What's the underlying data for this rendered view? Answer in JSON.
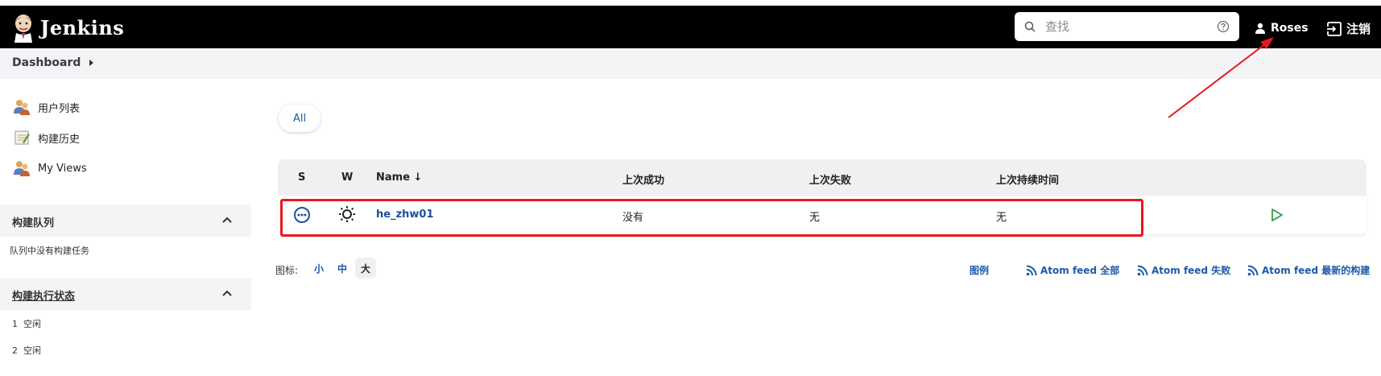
{
  "header": {
    "app_name": "Jenkins",
    "search_placeholder": "查找",
    "user_name": "Roses",
    "logout_label": "注销"
  },
  "breadcrumb": {
    "items": [
      "Dashboard"
    ]
  },
  "sidebar": {
    "tasks": [
      {
        "label": "用户列表",
        "icon": "users-icon"
      },
      {
        "label": "构建历史",
        "icon": "notepad-icon"
      },
      {
        "label": "My Views",
        "icon": "users-icon"
      }
    ],
    "build_queue": {
      "title": "构建队列",
      "empty_text": "队列中没有构建任务"
    },
    "executors": {
      "title": "构建执行状态",
      "items": [
        {
          "num": "1",
          "status": "空闲"
        },
        {
          "num": "2",
          "status": "空闲"
        }
      ]
    }
  },
  "main": {
    "tabs": [
      {
        "label": "All"
      }
    ],
    "table": {
      "columns": [
        "S",
        "W",
        "Name ↓",
        "上次成功",
        "上次失败",
        "上次持续时间"
      ],
      "rows": [
        {
          "status_icon": "not-built-icon",
          "weather_icon": "sunny-icon",
          "name": "he_zhw01",
          "last_success": "没有",
          "last_failure": "无",
          "last_duration": "无",
          "action_icon": "play-icon"
        }
      ]
    },
    "icon_size": {
      "label": "图标:",
      "options": [
        "小",
        "中",
        "大"
      ],
      "selected": "大"
    },
    "legend_links": [
      "图例",
      "Atom feed 全部",
      "Atom feed 失败",
      "Atom feed 最新的构建"
    ]
  },
  "colors": {
    "header_bg": "#000000",
    "link": "#1b5aa8",
    "highlight": "#e8171d",
    "success_green": "#2f9e44"
  }
}
